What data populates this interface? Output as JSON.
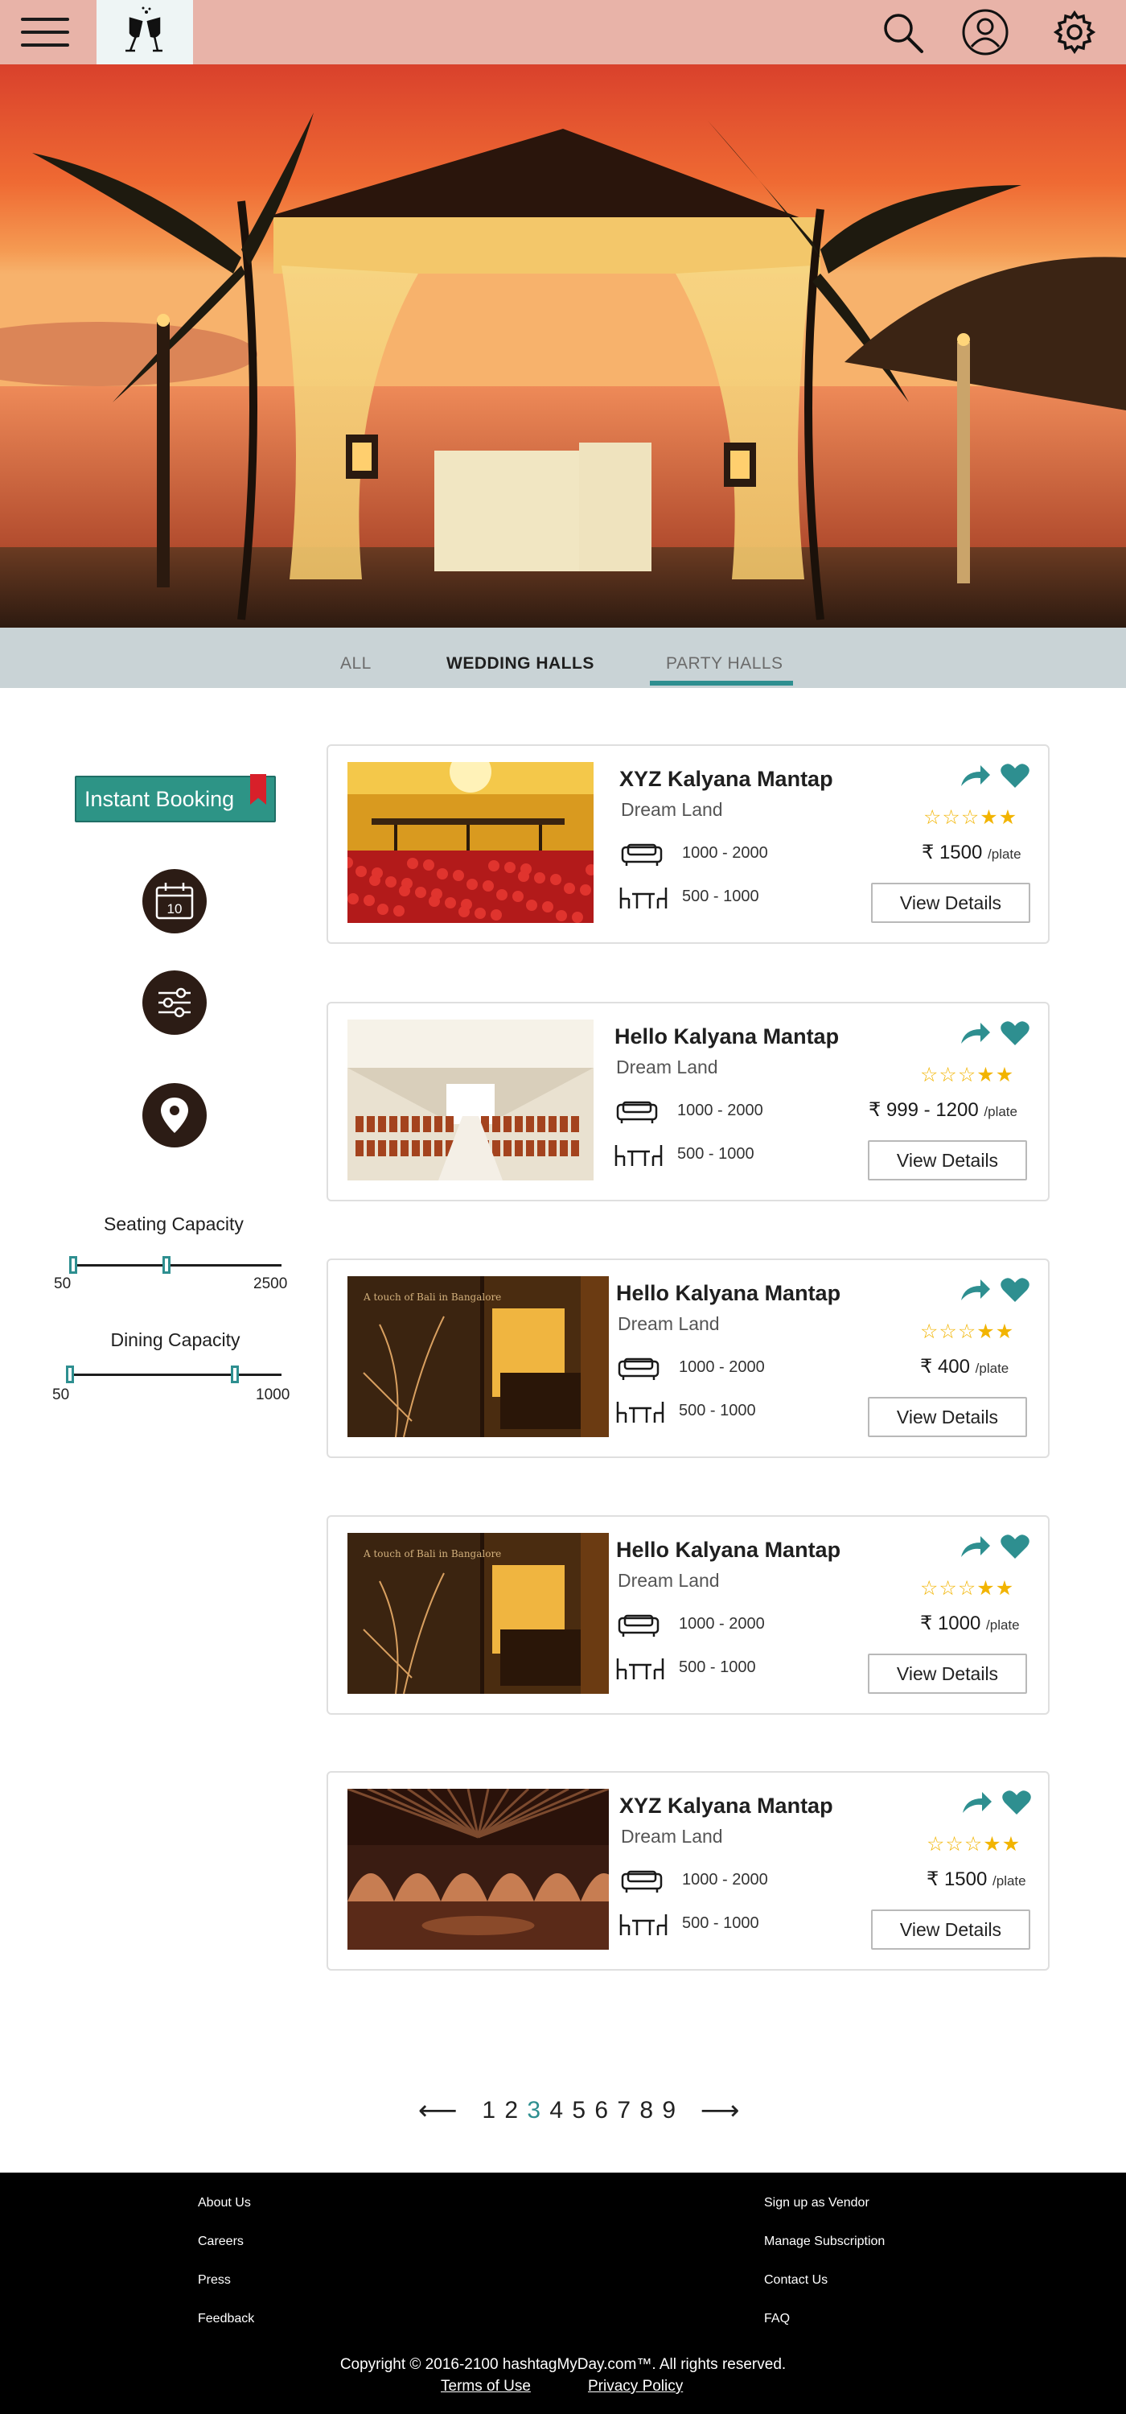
{
  "header": {
    "menu_icon": "hamburger-menu-icon",
    "logo_icon": "champagne-glasses-icon",
    "search_icon": "search-icon",
    "profile_icon": "user-profile-icon",
    "settings_icon": "gear-icon"
  },
  "colors": {
    "header_bg": "#e8b3a8",
    "accent": "#2e8f90",
    "instant_booking": "#2d9486",
    "footer_bg": "#000000",
    "star": "#f2b400",
    "bookmark": "#d8202a"
  },
  "tabs": [
    {
      "label": "ALL",
      "active": false
    },
    {
      "label": "WEDDING HALLS",
      "active": false
    },
    {
      "label": "PARTY HALLS",
      "active": true
    }
  ],
  "sidebar": {
    "instant_booking_label": "Instant Booking",
    "calendar_day": "10",
    "calendar_icon": "calendar-icon",
    "filter_icon": "filter-sliders-icon",
    "location_icon": "location-pin-icon",
    "seating": {
      "label": "Seating Capacity",
      "min": "50",
      "max": "2500",
      "low": 0,
      "high": 0.45
    },
    "dining": {
      "label": "Dining Capacity",
      "min": "50",
      "max": "1000",
      "low": 0,
      "high": 0.78
    }
  },
  "listings": [
    {
      "name": "XYZ Kalyana Mantap",
      "location": "Dream Land",
      "seating": "1000 - 2000",
      "dining": "500 - 1000",
      "stars_filled": 2,
      "stars_total": 5,
      "rupee": "₹",
      "price": "1500",
      "price_unit": "/plate",
      "button": "View Details",
      "favorite": true
    },
    {
      "name": "Hello Kalyana Mantap",
      "location": "Dream Land",
      "seating": "1000 - 2000",
      "dining": "500 - 1000",
      "stars_filled": 2,
      "stars_total": 5,
      "rupee": "₹",
      "price": "999 - 1200",
      "price_unit": "/plate",
      "button": "View Details",
      "favorite": true
    },
    {
      "name": "Hello Kalyana Mantap",
      "location": "Dream Land",
      "seating": "1000 - 2000",
      "dining": "500 - 1000",
      "stars_filled": 2,
      "stars_total": 5,
      "rupee": "₹",
      "price": "400",
      "price_unit": "/plate",
      "button": "View Details",
      "favorite": true
    },
    {
      "name": "Hello Kalyana Mantap",
      "location": "Dream Land",
      "seating": "1000 - 2000",
      "dining": "500 - 1000",
      "stars_filled": 2,
      "stars_total": 5,
      "rupee": "₹",
      "price": "1000",
      "price_unit": "/plate",
      "button": "View Details",
      "favorite": true
    },
    {
      "name": "XYZ Kalyana Mantap",
      "location": "Dream Land",
      "seating": "1000 - 2000",
      "dining": "500 - 1000",
      "stars_filled": 2,
      "stars_total": 5,
      "rupee": "₹",
      "price": "1500",
      "price_unit": "/plate",
      "button": "View Details",
      "favorite": true
    }
  ],
  "pagination": {
    "prev_icon": "arrow-left-icon",
    "next_icon": "arrow-right-icon",
    "pages": [
      "1",
      "2",
      "3",
      "4",
      "5",
      "6",
      "7",
      "8",
      "9"
    ],
    "current": "3"
  },
  "footer": {
    "left_links": [
      "About Us",
      "Careers",
      "Press",
      "Feedback"
    ],
    "right_links": [
      "Sign up as Vendor",
      "Manage Subscription",
      "Contact Us",
      "FAQ"
    ],
    "copyright": "Copyright © 2016-2100 hashtagMyDay.com™. All rights reserved.",
    "terms": "Terms of Use",
    "privacy": "Privacy Policy"
  }
}
